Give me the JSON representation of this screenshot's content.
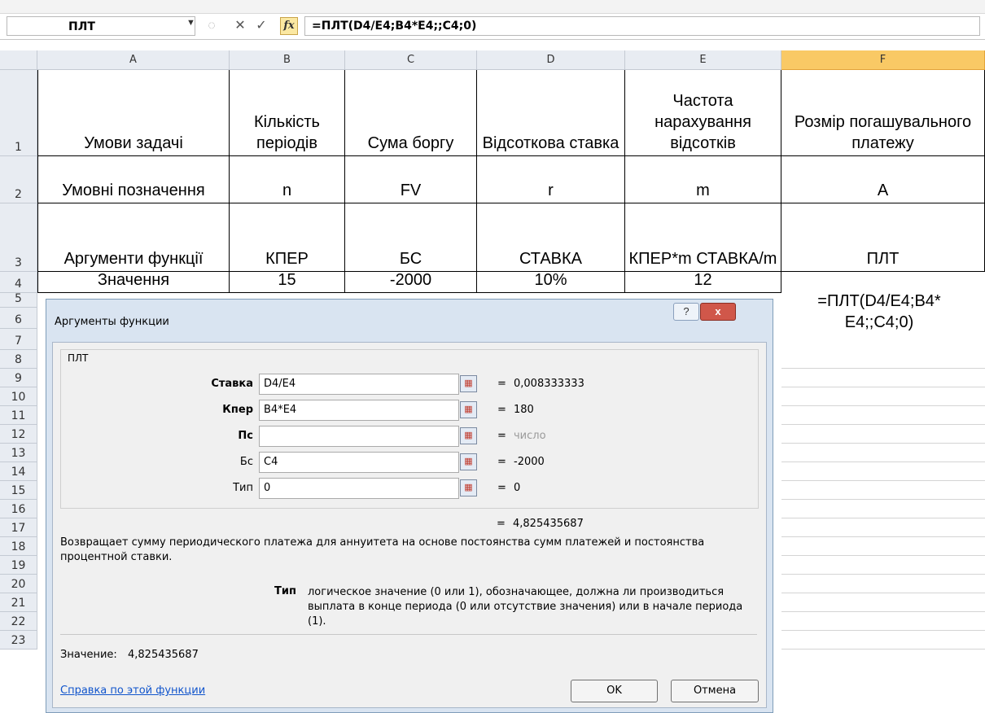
{
  "formula_bar": {
    "name_box": "ПЛТ",
    "cancel_symbol": "✕",
    "enter_symbol": "✓",
    "fx_label": "fx",
    "formula": "=ПЛТ(D4/E4;B4*E4;;C4;0)"
  },
  "columns": [
    "A",
    "B",
    "C",
    "D",
    "E",
    "F"
  ],
  "rows": [
    "1",
    "2",
    "3",
    "4",
    "5",
    "6",
    "7",
    "8",
    "9",
    "10",
    "11",
    "12",
    "13",
    "14",
    "15",
    "16",
    "17",
    "18",
    "19",
    "20",
    "21",
    "22",
    "23"
  ],
  "table": {
    "r1": [
      "Умови задачі",
      "Кількість періодів",
      "Сума боргу",
      "Відсоткова ставка",
      "Частота нарахування відсотків",
      "Розмір погашувального платежу"
    ],
    "r2": [
      "Умовні позначення",
      "n",
      "FV",
      "r",
      "m",
      "A"
    ],
    "r3": [
      "Аргументи функції",
      "КПЕР",
      "БС",
      "СТАВКА",
      "КПЕР*m СТАВКА/m",
      "ПЛТ"
    ],
    "r4": [
      "Значення",
      "15",
      "-2000",
      "10%",
      "12"
    ]
  },
  "f_formula_display": "=ПЛТ(D4/E4;B4* E4;;C4;0)",
  "dialog": {
    "title": "Аргументы функции",
    "help_symbol": "?",
    "close_symbol": "x",
    "function_name": "ПЛТ",
    "args": [
      {
        "label": "Ставка",
        "value": "D4/E4",
        "result": "0,008333333"
      },
      {
        "label": "Кпер",
        "value": "B4*E4",
        "result": "180"
      },
      {
        "label": "Пс",
        "value": "",
        "result": "число"
      },
      {
        "label": "Бс",
        "value": "C4",
        "result": "-2000"
      },
      {
        "label": "Тип",
        "value": "0",
        "result": "0"
      }
    ],
    "eq": "=",
    "total_result": "4,825435687",
    "description": "Возвращает сумму периодического платежа для аннуитета на основе постоянства сумм платежей и постоянства процентной ставки.",
    "arg_help_name": "Тип",
    "arg_help_text": "логическое значение (0 или 1), обозначающее, должна ли производиться выплата в конце периода (0 или отсутствие значения) или в начале периода (1).",
    "value_label": "Значение:",
    "value": "4,825435687",
    "help_link": "Справка по этой функции",
    "ok_label": "OK",
    "cancel_label": "Отмена"
  }
}
